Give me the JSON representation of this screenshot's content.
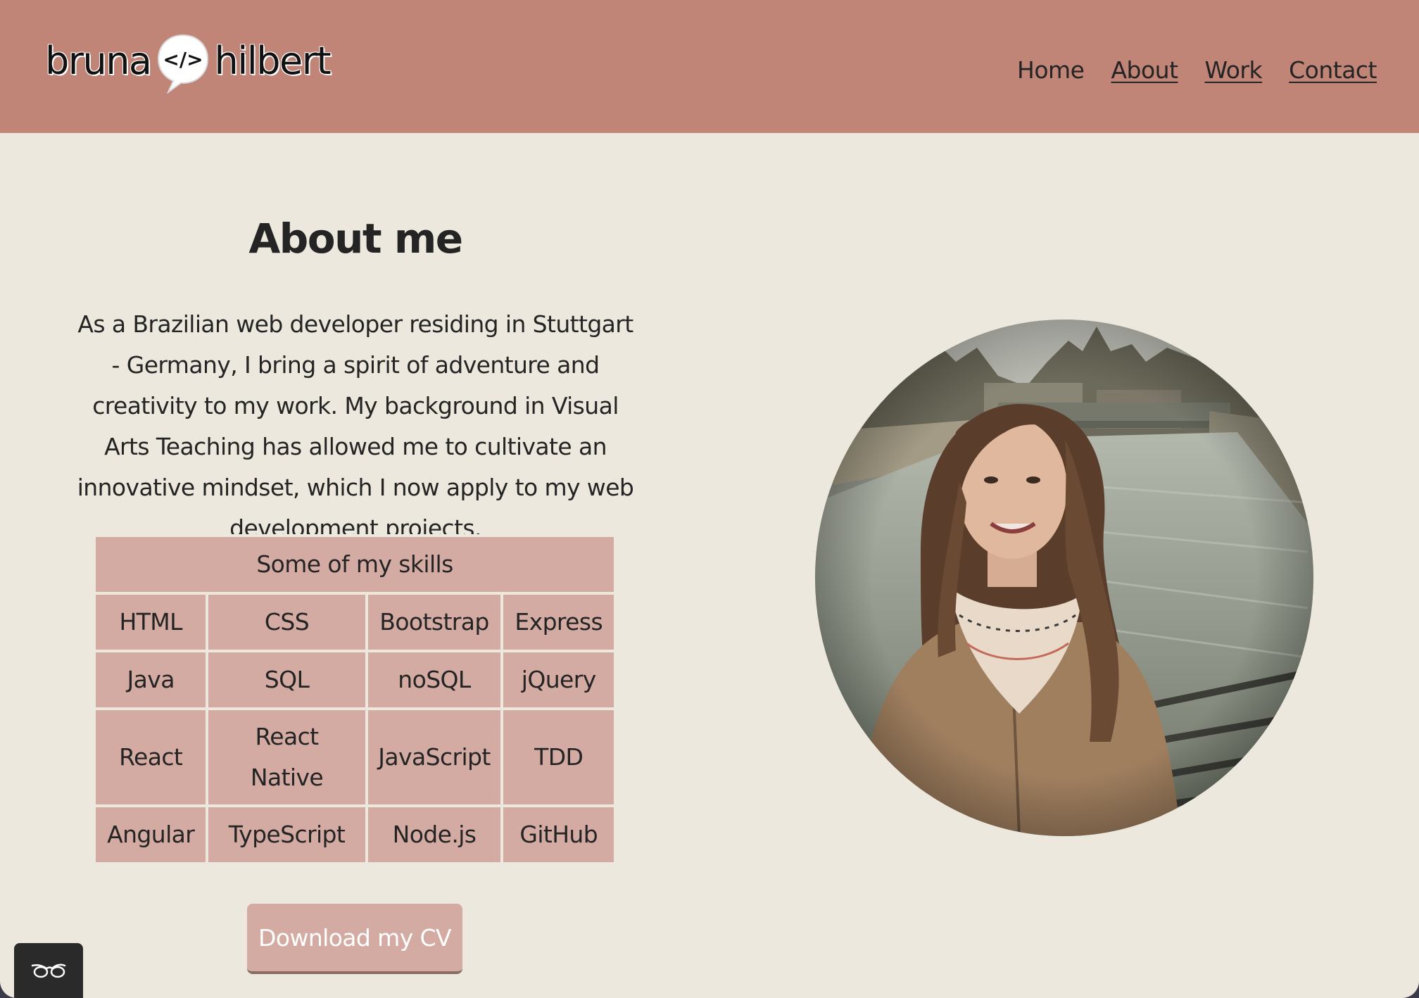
{
  "header": {
    "logo": {
      "left_word": "bruna",
      "bubble_symbol": "</>",
      "right_word": "hilbert"
    },
    "nav": [
      {
        "label": "Home",
        "underlined": false
      },
      {
        "label": "About",
        "underlined": true
      },
      {
        "label": "Work",
        "underlined": true
      },
      {
        "label": "Contact",
        "underlined": true
      }
    ]
  },
  "about": {
    "title": "About me",
    "paragraph": "As a Brazilian web developer residing in Stuttgart - Germany, I bring a spirit of adventure and creativity to my work. My background in Visual Arts Teaching has allowed me to cultivate an innovative mindset, which I now apply to my web development projects."
  },
  "skills": {
    "caption": "Some of my skills",
    "rows": [
      [
        "HTML",
        "CSS",
        "Bootstrap",
        "Express"
      ],
      [
        "Java",
        "SQL",
        "noSQL",
        "jQuery"
      ],
      [
        "React",
        "React Native",
        "JavaScript",
        "TDD"
      ],
      [
        "Angular",
        "TypeScript",
        "Node.js",
        "GitHub"
      ]
    ]
  },
  "cv_button": {
    "label": "Download my CV"
  },
  "photo": {
    "icon": "portrait-photo"
  },
  "accessibility_widget": {
    "icon": "glasses-icon"
  },
  "colors": {
    "header_bg": "#c08577",
    "page_bg": "#ede8dd",
    "cell_bg": "#d4aba3",
    "text": "#242424",
    "widget_bg": "#2a2a2a"
  }
}
